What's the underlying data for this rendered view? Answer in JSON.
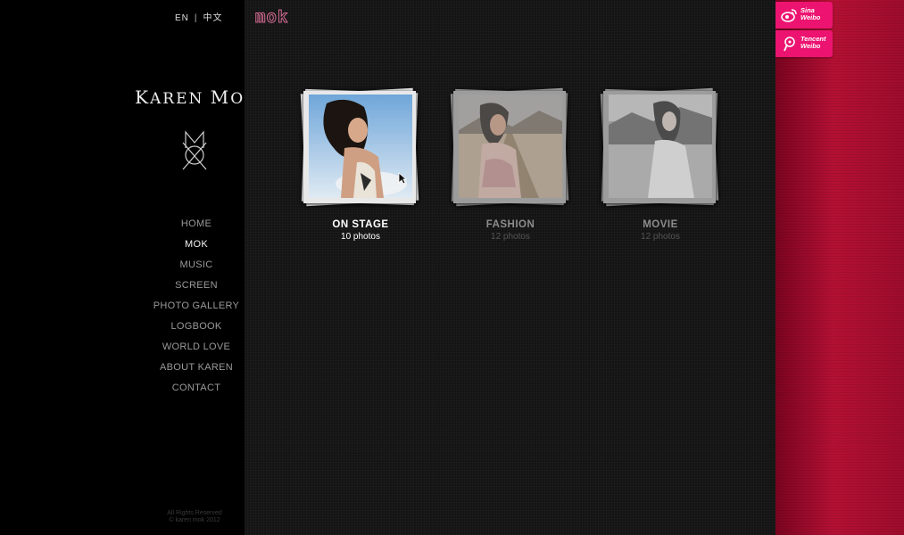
{
  "language": {
    "en": "EN",
    "separator": "|",
    "zh": "中文"
  },
  "logo": {
    "name_first": "K",
    "name_rest_1": "AREN ",
    "name_m": "M",
    "name_rest_2": "OK"
  },
  "nav": {
    "items": [
      {
        "label": "HOME",
        "active": false
      },
      {
        "label": "MOK",
        "active": true
      },
      {
        "label": "MUSIC",
        "active": false
      },
      {
        "label": "SCREEN",
        "active": false
      },
      {
        "label": "PHOTO GALLERY",
        "active": false
      },
      {
        "label": "LOGBOOK",
        "active": false
      },
      {
        "label": "WORLD LOVE",
        "active": false
      },
      {
        "label": "ABOUT KAREN",
        "active": false
      },
      {
        "label": "CONTACT",
        "active": false
      }
    ]
  },
  "footer": {
    "line1": "All Rights Reserved",
    "line2": "© karen mok 2012"
  },
  "brand": "mok",
  "albums": [
    {
      "title": "ON STAGE",
      "count": "10 photos",
      "selected": true
    },
    {
      "title": "FASHION",
      "count": "12 photos",
      "selected": false
    },
    {
      "title": "MOVIE",
      "count": "12 photos",
      "selected": false
    }
  ],
  "social": {
    "sina": {
      "line1": "Sina",
      "line2": "Weibo"
    },
    "tencent": {
      "line1": "Tencent",
      "line2": "Weibo"
    }
  },
  "colors": {
    "accent": "#ec1470",
    "panel_red": "#b41034",
    "background": "#141414"
  }
}
